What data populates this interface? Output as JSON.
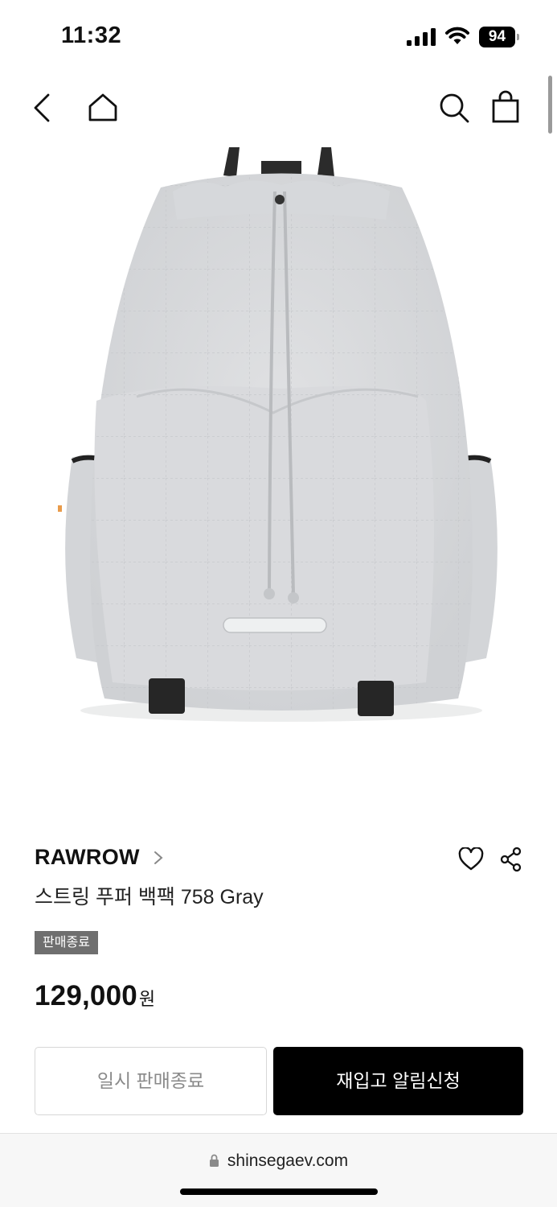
{
  "status_bar": {
    "time": "11:32",
    "battery": "94",
    "icons": [
      "signal-icon",
      "wifi-icon",
      "battery-icon"
    ]
  },
  "header": {
    "icons": [
      "back-icon",
      "home-icon",
      "search-icon",
      "shopping-bag-icon"
    ]
  },
  "product": {
    "brand": "RAWROW",
    "title": "스트링 푸퍼 백팩 758 Gray",
    "badge": "판매종료",
    "price": "129,000",
    "price_unit": "원",
    "image_color": "#d9dadc",
    "actions": [
      "heart-icon",
      "share-icon"
    ]
  },
  "buttons": {
    "soldout_label": "일시 판매종료",
    "restock_label": "재입고 알림신청"
  },
  "browser": {
    "url": "shinsegaev.com"
  },
  "colors": {
    "badge_bg": "#6f6f6f",
    "primary_button": "#000000",
    "disabled_text": "#8a8a8a"
  }
}
